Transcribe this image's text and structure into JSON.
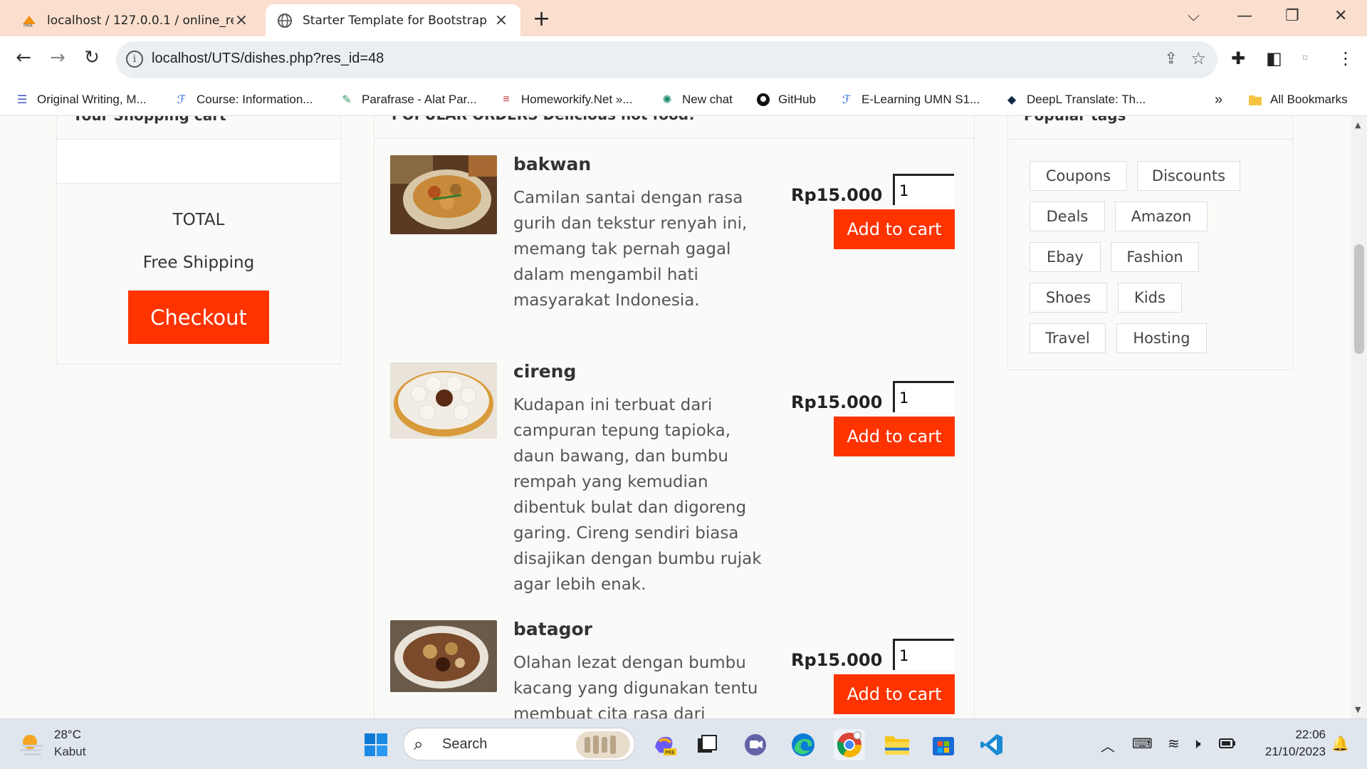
{
  "browser": {
    "tabs": [
      {
        "title": "localhost / 127.0.0.1 / online_res",
        "active": false
      },
      {
        "title": "Starter Template for Bootstrap",
        "active": true
      }
    ],
    "url": "localhost/UTS/dishes.php?res_id=48",
    "bookmarks": [
      "Original Writing, M...",
      "Course: Information...",
      "Parafrase - Alat Par...",
      "Homeworkify.Net »...",
      "New chat",
      "GitHub",
      "E-Learning UMN S1...",
      "DeepL Translate: Th..."
    ],
    "bookmarks_overflow": "»",
    "all_bookmarks": "All Bookmarks"
  },
  "cart": {
    "heading": "Your Shopping cart",
    "total_label": "TOTAL",
    "shipping_label": "Free Shipping",
    "checkout_label": "Checkout"
  },
  "orders": {
    "heading": "POPULAR ORDERS Delicious hot food!",
    "dishes": [
      {
        "name": "bakwan",
        "description": "Camilan santai dengan rasa gurih dan tekstur renyah ini, memang tak pernah gagal dalam mengambil hati masyarakat Indonesia.",
        "price": "Rp15.000",
        "qty": "1",
        "button": "Add to cart"
      },
      {
        "name": "cireng",
        "description": "Kudapan ini terbuat dari campuran tepung tapioka, daun bawang, dan bumbu rempah yang kemudian dibentuk bulat dan digoreng garing. Cireng sendiri biasa disajikan dengan bumbu rujak agar lebih enak.",
        "price": "Rp15.000",
        "qty": "1",
        "button": "Add to cart"
      },
      {
        "name": "batagor",
        "description": "Olahan lezat dengan bumbu kacang yang digunakan tentu membuat cita rasa dari",
        "price": "Rp15.000",
        "qty": "1",
        "button": "Add to cart"
      }
    ]
  },
  "tags": {
    "heading": "Popular tags",
    "items": [
      "Coupons",
      "Discounts",
      "Deals",
      "Amazon",
      "Ebay",
      "Fashion",
      "Shoes",
      "Kids",
      "Travel",
      "Hosting"
    ]
  },
  "taskbar": {
    "weather_temp": "28°C",
    "weather_desc": "Kabut",
    "search_placeholder": "Search",
    "time": "22:06",
    "date": "21/10/2023"
  },
  "colors": {
    "accent": "#ff3300",
    "tabbar": "#fadfce"
  }
}
